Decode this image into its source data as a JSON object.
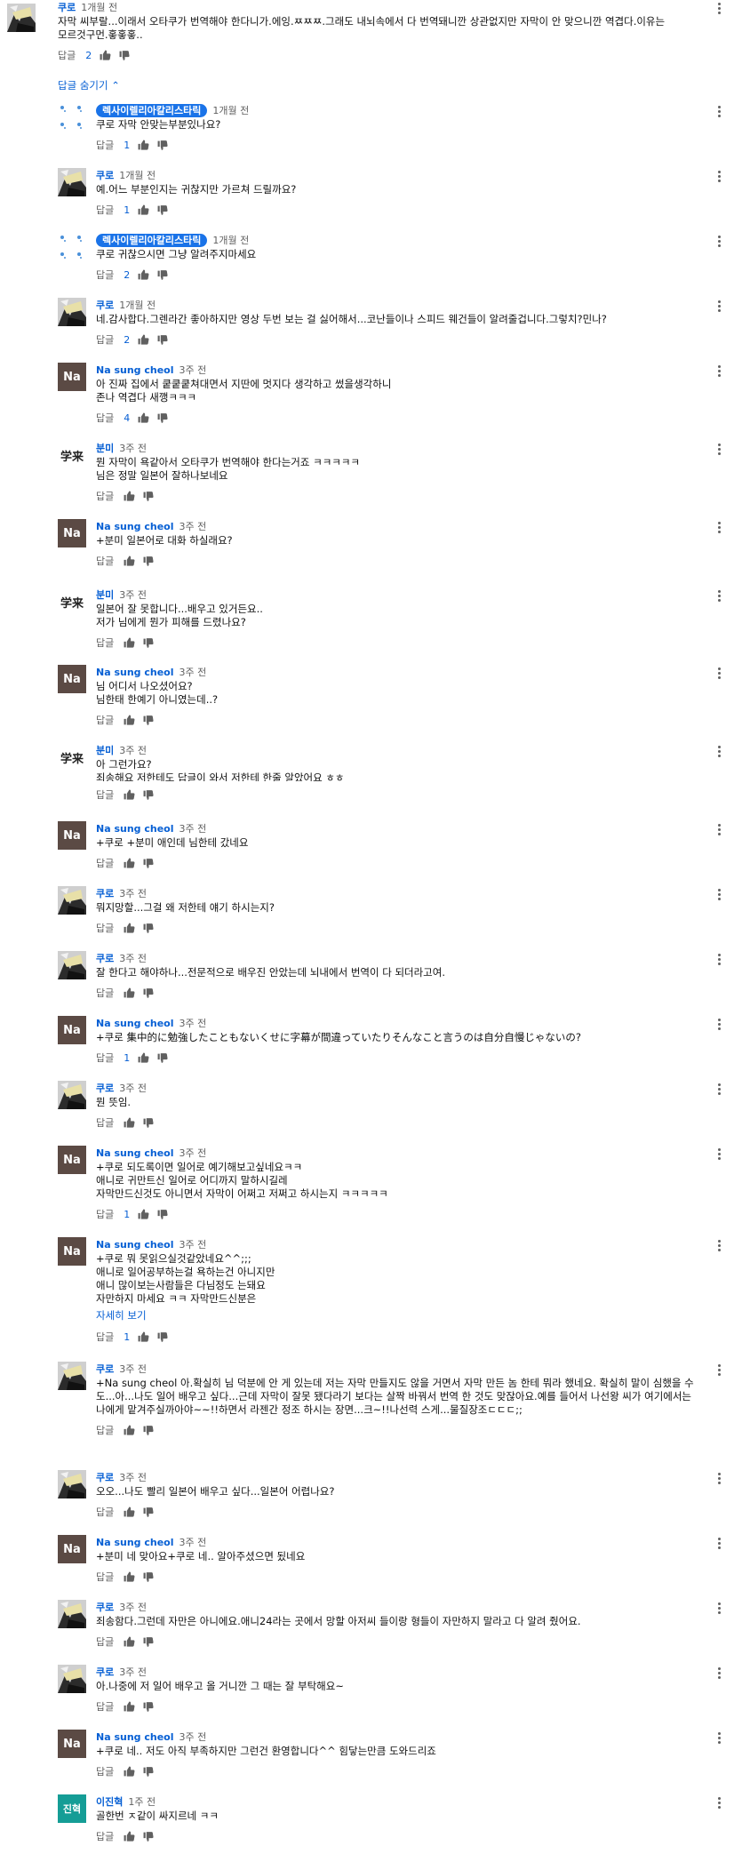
{
  "ui": {
    "reply_label": "답글",
    "hide_replies": "답글 숨기기",
    "show_more": "자세히 보기"
  },
  "comments": [
    {
      "author": "쿠로",
      "time": "1개월 전",
      "avatar": "manga-icon",
      "text": "자막 씨부랄...이래서 오타쿠가 번역해야 한다니가.에잉.ㅉㅉㅉ.그래도 내뇌속에서 다 번역돼니깐 상관없지만 자막이 안 맞으니깐 역겹다.이유는 모르것구먼.홓홓홓..",
      "likes": "2"
    },
    {
      "author": "렉사이렐리아칼리스타릭",
      "time": "1개월 전",
      "avatar": "dots-icon",
      "chip": true,
      "text": "쿠로 자막 안맞는부분있나요?",
      "likes": "1"
    },
    {
      "author": "쿠로",
      "time": "1개월 전",
      "avatar": "manga-icon",
      "text": "예.어느 부분인지는 귀찮지만 가르쳐 드릴까요?",
      "likes": "1"
    },
    {
      "author": "렉사이렐리아칼리스타릭",
      "time": "1개월 전",
      "avatar": "dots-icon",
      "chip": true,
      "text": "쿠로 귀찮으시면 그냥 알려주지마세요",
      "likes": "2"
    },
    {
      "author": "쿠로",
      "time": "1개월 전",
      "avatar": "manga-icon",
      "text": "네.감사합다.그렌라간 좋아하지만 영상 두번 보는 걸 싫어해서...코난들이나 스피드 웨건들이 알려줄겁니다.그렇치?민나?",
      "likes": "2"
    },
    {
      "author": "Na sung cheol",
      "time": "3주 전",
      "avatar": "na-icon",
      "avatar_text": "Na",
      "text": "아 진짜 집에서 쿹쿹쿹쳐대면서 지딴에 멋지다 생각하고 썼을생각하니\n존나 역겹다 새깽ㅋㅋㅋ",
      "likes": "4"
    },
    {
      "author": "분미",
      "time": "3주 전",
      "avatar": "cjk-icon",
      "avatar_text": "学来",
      "text": "뭔 자막이 욕같아서 오타쿠가 번역해야 한다는거죠 ㅋㅋㅋㅋㅋ\n님은 정말 일본어 잘하나보네요",
      "likes": ""
    },
    {
      "author": "Na sung cheol",
      "time": "3주 전",
      "avatar": "na-icon",
      "avatar_text": "Na",
      "text": "+분미 일본어로 대화 하실래요?",
      "likes": ""
    },
    {
      "author": "분미",
      "time": "3주 전",
      "avatar": "cjk-icon",
      "avatar_text": "学来",
      "text": "일본어 잘 못합니다...배우고 있거든요..\n저가 님에게 뭔가 피해를 드렸나요?",
      "likes": ""
    },
    {
      "author": "Na sung cheol",
      "time": "3주 전",
      "avatar": "na-icon",
      "avatar_text": "Na",
      "text": "님 어디서 나오셨어요?\n님한태 한예기 아니였는데..?",
      "likes": ""
    },
    {
      "author": "분미",
      "time": "3주 전",
      "avatar": "cjk-icon",
      "avatar_text": "学来",
      "text": "아 그런가요?\n죄송해요 저한테도 답글이 와서 저한테 한줄 알았어요 ㅎㅎ",
      "likes": "",
      "clipped": true
    },
    {
      "author": "Na sung cheol",
      "time": "3주 전",
      "avatar": "na-icon",
      "avatar_text": "Na",
      "text": "+쿠로 +분미 애인데 님한테 갔네요",
      "likes": ""
    },
    {
      "author": "쿠로",
      "time": "3주 전",
      "avatar": "manga-icon",
      "text": "뭐지망할...그걸 왜 저한테 얘기 하시는지?",
      "likes": ""
    },
    {
      "author": "쿠로",
      "time": "3주 전",
      "avatar": "manga-icon",
      "text": "잘 한다고 해야하나...전문적으로 배우진 안았는데 뇌내에서 번역이 다 되더라고여.",
      "likes": ""
    },
    {
      "author": "Na sung cheol",
      "time": "3주 전",
      "avatar": "na-icon",
      "avatar_text": "Na",
      "text": "+쿠로 集中的に勉強したこともないくせに字幕が間違っていたりそんなこと言うのは自分自慢じゃないの?",
      "likes": "1"
    },
    {
      "author": "쿠로",
      "time": "3주 전",
      "avatar": "manga-icon",
      "text": "뭔 뜻임.",
      "likes": ""
    },
    {
      "author": "Na sung cheol",
      "time": "3주 전",
      "avatar": "na-icon",
      "avatar_text": "Na",
      "text": "+쿠로 되도록이면 일어로 예기해보고싶네요ㅋㅋ\n애니로 귀만트신 일어로 어디까지 말하시길레\n자막만드신것도 아니면서 자막이 어쩌고 저쩌고 하시는지 ㅋㅋㅋㅋㅋ",
      "likes": "1"
    },
    {
      "author": "Na sung cheol",
      "time": "3주 전",
      "avatar": "na-icon",
      "avatar_text": "Na",
      "text": "+쿠로 뭐 못읽으실것같았네요^^;;;\n애니로 일어공부하는걸 욕하는건 아니지만\n애니 많이보는사람들은 다님정도 는돼요\n자만하지 마세요 ㅋㅋ 자막만드신분은",
      "likes": "1",
      "more": true
    },
    {
      "author": "쿠로",
      "time": "3주 전",
      "avatar": "manga-icon",
      "text": "+Na sung cheol 아.확실히 님 덕분에 안 게 있는데 저는 자막 만들지도 않을 거면서 자막 만든 놈 한테 뭐라 했네요. 확실히 말이 심했을 수 도...아...나도 일어 배우고 싶다...근데 자막이 잘못 됐다라기 보다는 살짝 바꿔서 번역 한 것도 맞잖아요.예를 들어서 나선왕 씨가 여기에서는 나에게 맡겨주실까아야~~!!하면서 라젠간 정조 하시는 장면...크~!!나선력 스게...물질장조ㄷㄷㄷ;;",
      "likes": ""
    },
    {
      "author": "쿠로",
      "time": "3주 전",
      "avatar": "manga-icon",
      "text": "오오...나도 빨리 일본어 배우고 싶다...일본어 어렵나요?",
      "likes": ""
    },
    {
      "author": "Na sung cheol",
      "time": "3주 전",
      "avatar": "na-icon",
      "avatar_text": "Na",
      "text": "+분미 네 맞아요+쿠로 네.. 알아주셨으면 됬네요",
      "likes": ""
    },
    {
      "author": "쿠로",
      "time": "3주 전",
      "avatar": "manga-icon",
      "text": "죄송함다.그런데 자만은 아니에요.애니24라는 곳에서 망할 아저씨 들이랑 형들이 자만하지 말라고 다 알려 줬어요.",
      "likes": ""
    },
    {
      "author": "쿠로",
      "time": "3주 전",
      "avatar": "manga-icon",
      "text": "아.나중에 저 일어 배우고 올 거니깐 그 때는 잘 부탁해요~",
      "likes": ""
    },
    {
      "author": "Na sung cheol",
      "time": "3주 전",
      "avatar": "na-icon",
      "avatar_text": "Na",
      "text": "+쿠로 네.. 저도 아직 부족하지만 그런건 환영합니다^^ 힘닿는만큼 도와드리죠",
      "likes": ""
    },
    {
      "author": "이진혁",
      "time": "1주 전",
      "avatar": "initials-icon",
      "avatar_text": "진혁",
      "text": "골한번 ㅈ같이 싸지르네 ㅋㅋ",
      "likes": ""
    }
  ]
}
